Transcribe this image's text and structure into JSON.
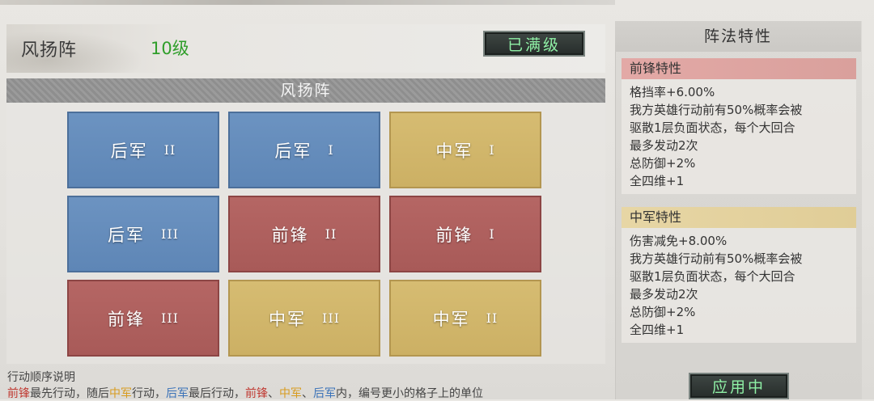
{
  "header": {
    "title": "风扬阵",
    "level": "10级",
    "max_button": "已满级"
  },
  "grid": {
    "title": "风扬阵",
    "cells": [
      {
        "name": "后军",
        "num": "II",
        "color": "blue"
      },
      {
        "name": "后军",
        "num": "I",
        "color": "blue"
      },
      {
        "name": "中军",
        "num": "I",
        "color": "gold"
      },
      {
        "name": "后军",
        "num": "III",
        "color": "blue"
      },
      {
        "name": "前锋",
        "num": "II",
        "color": "red"
      },
      {
        "name": "前锋",
        "num": "I",
        "color": "red"
      },
      {
        "name": "前锋",
        "num": "III",
        "color": "red"
      },
      {
        "name": "中军",
        "num": "III",
        "color": "gold"
      },
      {
        "name": "中军",
        "num": "II",
        "color": "gold"
      }
    ]
  },
  "note": {
    "title": "行动顺序说明",
    "p1": "前锋",
    "p2": "最先行动，随后",
    "p3": "中军",
    "p4": "行动，",
    "p5": "后军",
    "p6": "最后行动，",
    "p7": "前锋",
    "p8": "、",
    "p9": "中军",
    "p10": "、",
    "p11": "后军",
    "p12": "内，编号更小的格子上的单位"
  },
  "sidebar": {
    "title": "阵法特性",
    "sections": [
      {
        "header": "前锋特性",
        "lines": [
          "格挡率+6.00%",
          "我方英雄行动前有50%概率会被",
          "驱散1层负面状态，每个大回合",
          "最多发动2次",
          "总防御+2%",
          "全四维+1"
        ]
      },
      {
        "header": "中军特性",
        "lines": [
          "伤害减免+8.00%",
          "我方英雄行动前有50%概率会被",
          "驱散1层负面状态，每个大回合",
          "最多发动2次",
          "总防御+2%",
          "全四维+1"
        ]
      }
    ],
    "apply_button": "应用中"
  }
}
